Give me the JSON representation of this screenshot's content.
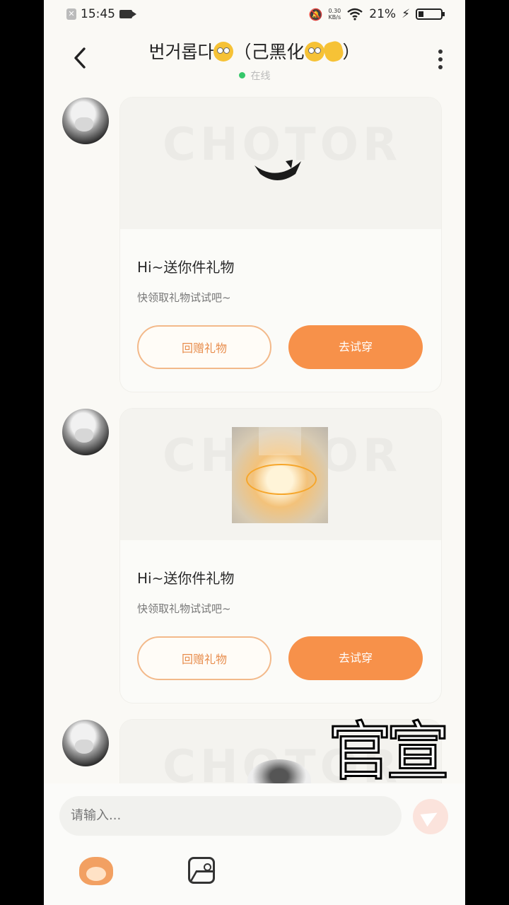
{
  "status_bar": {
    "time": "15:45",
    "speed_value": "0.30",
    "speed_unit": "KB/s",
    "battery": "21%"
  },
  "header": {
    "title_prefix": "번거롭다",
    "title_mid": "（己黑化",
    "title_suffix": "）",
    "status": "在线"
  },
  "messages": [
    {
      "title": "Hi~送你件礼物",
      "subtitle": "快领取礼物试试吧~",
      "return_label": "回赠礼物",
      "try_label": "去试穿"
    },
    {
      "title": "Hi~送你件礼物",
      "subtitle": "快领取礼物试试吧~",
      "return_label": "回赠礼物",
      "try_label": "去试穿"
    }
  ],
  "overlay": {
    "text": "官宣"
  },
  "composer": {
    "placeholder": "请输入..."
  }
}
